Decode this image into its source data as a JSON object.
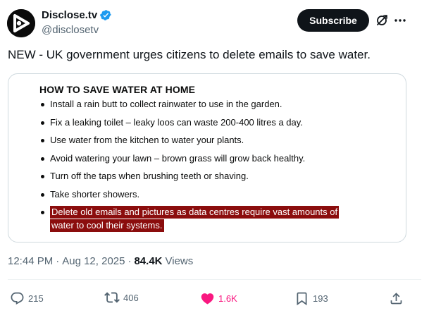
{
  "author": {
    "display_name": "Disclose.tv",
    "handle": "@disclosetv",
    "verified": true
  },
  "header": {
    "subscribe_label": "Subscribe",
    "grok_icon": "grok-icon",
    "more_icon": "more-options-icon"
  },
  "tweet": {
    "text": "NEW - UK government urges citizens to delete emails to save water."
  },
  "media": {
    "heading": "HOW TO SAVE WATER AT HOME",
    "items": [
      "Install a rain butt to collect rainwater to use in the garden.",
      "Fix a leaking toilet – leaky loos can waste 200-400 litres a day.",
      "Use water from the kitchen to water your plants.",
      "Avoid watering your lawn – brown grass will grow back healthy.",
      "Turn off the taps when brushing teeth or shaving.",
      "Take shorter showers."
    ],
    "highlighted_item": {
      "line1": "Delete old emails and pictures as data centres require vast amounts of",
      "line2": "water to cool their systems."
    },
    "highlight_color": "#8b0d0d"
  },
  "meta": {
    "time": "12:44 PM",
    "separator": "·",
    "date": "Aug 12, 2025",
    "separator2": "·",
    "views_count": "84.4K",
    "views_label": "Views"
  },
  "actions": {
    "replies": "215",
    "reposts": "406",
    "likes": "1.6K",
    "bookmarks": "193"
  },
  "colors": {
    "text_primary": "#0f1419",
    "text_secondary": "#536471",
    "verified_blue": "#1d9bf0",
    "like_pink": "#f91880",
    "border": "#cfd9de"
  }
}
